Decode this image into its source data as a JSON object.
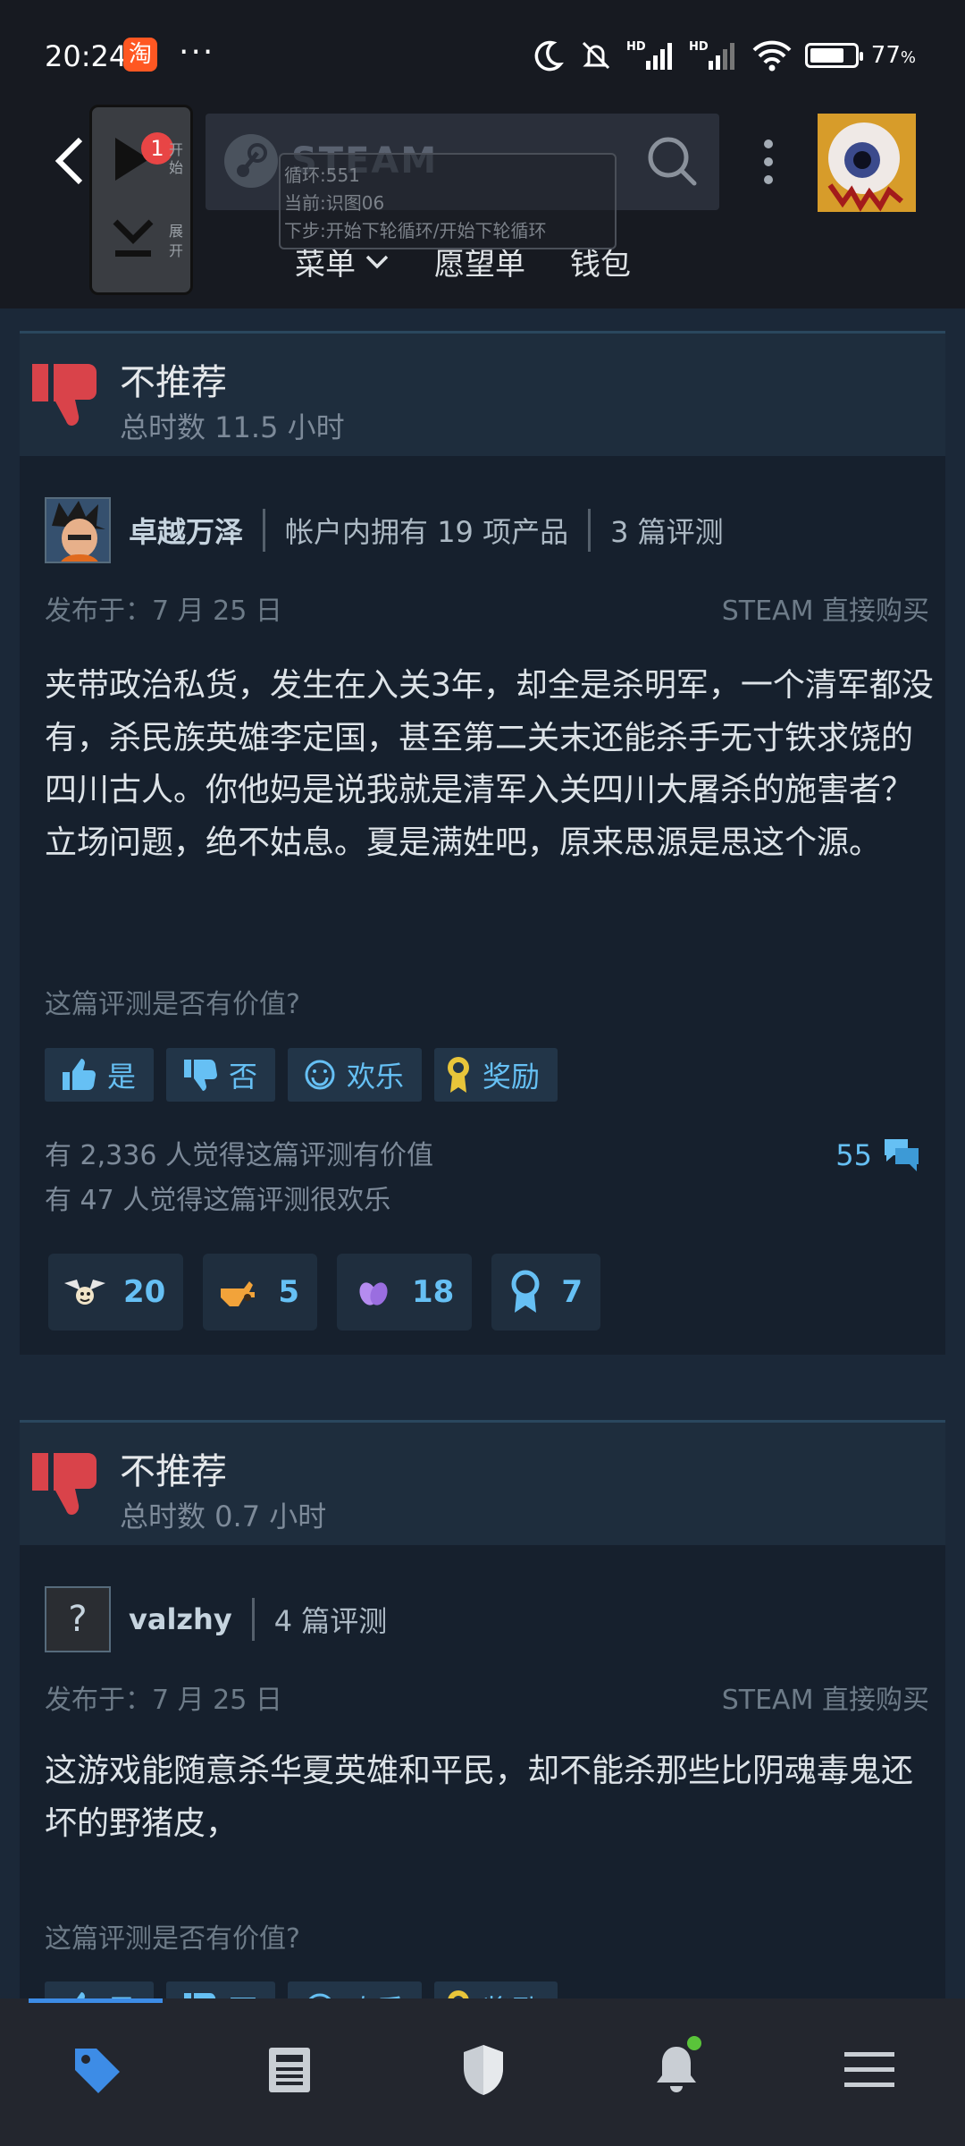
{
  "status_bar": {
    "time": "20:24",
    "taobao_icon": "淘",
    "more": "···",
    "battery_percent": "77",
    "battery_unit": "%",
    "battery_level": 0.77,
    "icons": [
      "moon-icon",
      "mute-icon",
      "signal-hd-icon",
      "signal-hd-icon",
      "wifi-icon",
      "battery-icon"
    ]
  },
  "top_nav": {
    "logo_text": "STEAM",
    "menu_label": "菜单",
    "wishlist_label": "愿望单",
    "wallet_label": "钱包"
  },
  "overlay_tool": {
    "badge": "1",
    "label_top": "开始",
    "label_bottom": "展开",
    "loop_line1": "循环:551",
    "loop_line2": "当前:识图06",
    "loop_line3": "下步:开始下轮循环/开始下轮循环"
  },
  "reviews": [
    {
      "verdict": "不推荐",
      "hours": "总时数 11.5 小时",
      "author": "卓越万泽",
      "products": "帐户内拥有 19 项产品",
      "review_count": "3 篇评测",
      "posted": "发布于：7 月 25 日",
      "source": "STEAM 直接购买",
      "body": "夹带政治私货，发生在入关3年，却全是杀明军，一个清军都没有，杀民族英雄李定国，甚至第二关末还能杀手无寸铁求饶的四川古人。你他妈是说我就是清军入关四川大屠杀的施害者？立场问题，绝不姑息。夏是满姓吧，原来思源是思这个源。",
      "question": "这篇评测是否有价值?",
      "buttons": {
        "yes": "是",
        "no": "否",
        "funny": "欢乐",
        "award": "奖励"
      },
      "helpful": "有 2,336 人觉得这篇评测有价值",
      "funny": "有 47 人觉得这篇评测很欢乐",
      "comments": "55",
      "awards": [
        "20",
        "5",
        "18",
        "7"
      ]
    },
    {
      "verdict": "不推荐",
      "hours": "总时数 0.7 小时",
      "author": "valzhy",
      "review_count": "4 篇评测",
      "posted": "发布于：7 月 25 日",
      "source": "STEAM 直接购买",
      "body": "这游戏能随意杀华夏英雄和平民，却不能杀那些比阴魂毒鬼还坏的野猪皮，",
      "question": "这篇评测是否有价值?",
      "buttons": {
        "yes": "是",
        "no": "否",
        "funny": "欢乐",
        "award": "奖励"
      },
      "avatar_placeholder": "?"
    }
  ],
  "bottom_nav": {
    "items": [
      "store-tag-icon",
      "news-icon",
      "guard-shield-icon",
      "notifications-bell-icon",
      "menu-icon"
    ]
  }
}
